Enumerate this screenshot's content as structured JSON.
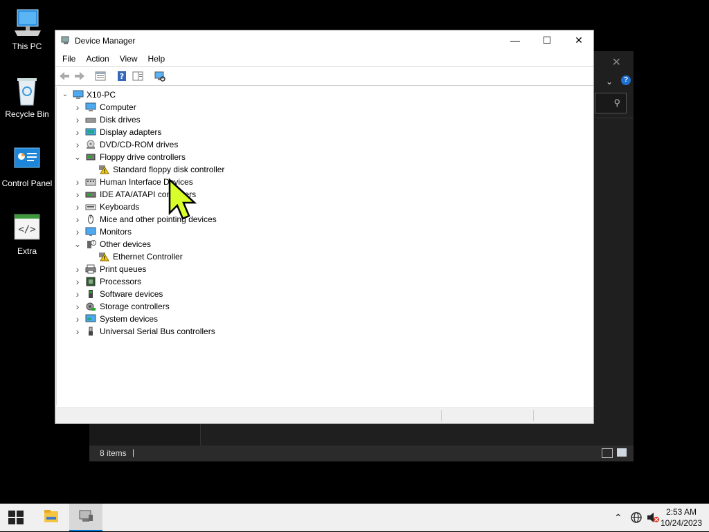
{
  "desktop": {
    "icons": [
      {
        "label": "This PC",
        "icon": "monitor-icon"
      },
      {
        "label": "Recycle Bin",
        "icon": "recycle-bin-icon"
      },
      {
        "label": "Control Panel",
        "icon": "control-panel-icon"
      },
      {
        "label": "Extra",
        "icon": "code-file-icon"
      }
    ]
  },
  "background_window": {
    "status_count": "8 items",
    "status_caret": "|",
    "help_label": "?"
  },
  "device_manager": {
    "title": "Device Manager",
    "window_buttons": {
      "minimize": "—",
      "maximize": "☐",
      "close": "✕"
    },
    "menu": [
      "File",
      "Action",
      "View",
      "Help"
    ],
    "toolbar": [
      "back-icon",
      "forward-icon",
      "properties-icon",
      "help-icon",
      "toggle-pane-icon",
      "scan-hardware-icon"
    ],
    "tree": {
      "root": {
        "label": "X10-PC",
        "expanded": true
      },
      "items": [
        {
          "label": "Computer",
          "expanded": false,
          "icon": "computer-icon",
          "level": 1
        },
        {
          "label": "Disk drives",
          "expanded": false,
          "icon": "disk-drive-icon",
          "level": 1
        },
        {
          "label": "Display adapters",
          "expanded": false,
          "icon": "display-adapter-icon",
          "level": 1
        },
        {
          "label": "DVD/CD-ROM drives",
          "expanded": false,
          "icon": "dvd-drive-icon",
          "level": 1
        },
        {
          "label": "Floppy drive controllers",
          "expanded": true,
          "icon": "floppy-controller-icon",
          "level": 1
        },
        {
          "label": "Standard floppy disk controller",
          "icon": "warning-device-icon",
          "level": 2
        },
        {
          "label": "Human Interface Devices",
          "expanded": false,
          "icon": "hid-icon",
          "level": 1
        },
        {
          "label": "IDE ATA/ATAPI controllers",
          "expanded": false,
          "icon": "ide-controller-icon",
          "level": 1
        },
        {
          "label": "Keyboards",
          "expanded": false,
          "icon": "keyboard-icon",
          "level": 1
        },
        {
          "label": "Mice and other pointing devices",
          "expanded": false,
          "icon": "mouse-icon",
          "level": 1
        },
        {
          "label": "Monitors",
          "expanded": false,
          "icon": "monitor-icon",
          "level": 1
        },
        {
          "label": "Other devices",
          "expanded": true,
          "icon": "unknown-device-icon",
          "level": 1
        },
        {
          "label": "Ethernet Controller",
          "icon": "warning-device-icon",
          "level": 2
        },
        {
          "label": "Print queues",
          "expanded": false,
          "icon": "printer-icon",
          "level": 1
        },
        {
          "label": "Processors",
          "expanded": false,
          "icon": "processor-icon",
          "level": 1
        },
        {
          "label": "Software devices",
          "expanded": false,
          "icon": "software-device-icon",
          "level": 1
        },
        {
          "label": "Storage controllers",
          "expanded": false,
          "icon": "storage-controller-icon",
          "level": 1
        },
        {
          "label": "System devices",
          "expanded": false,
          "icon": "system-device-icon",
          "level": 1
        },
        {
          "label": "Universal Serial Bus controllers",
          "expanded": false,
          "icon": "usb-icon",
          "level": 1
        }
      ]
    }
  },
  "taskbar": {
    "pinned": [
      "file-explorer-icon",
      "device-manager-icon"
    ],
    "active": "device-manager-icon",
    "tray": [
      "chevron-up-icon",
      "network-icon",
      "volume-muted-icon"
    ],
    "time": "2:53 AM",
    "date": "10/24/2023"
  },
  "colors": {
    "accent": "#0078d7",
    "desktop": "#000000",
    "warning": "#f2c811"
  }
}
